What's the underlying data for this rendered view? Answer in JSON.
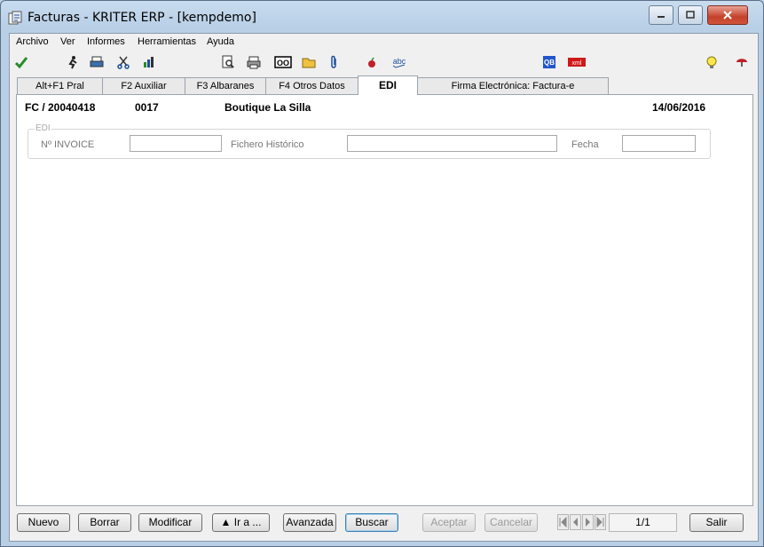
{
  "window": {
    "title": "Facturas - KRITER ERP - [kempdemo]"
  },
  "menu": [
    "Archivo",
    "Ver",
    "Informes",
    "Herramientas",
    "Ayuda"
  ],
  "toolbar": {
    "icons": [
      "check-icon",
      "run-icon",
      "print-icon",
      "scissors-icon",
      "chart-icon",
      "preview-icon",
      "printer-icon",
      "oo-icon",
      "folder-icon",
      "attach-icon",
      "apple-icon",
      "spellcheck-icon",
      "qb-icon",
      "xml-icon",
      "bulb-icon",
      "help-icon"
    ],
    "text_icons": {
      "oo": "OO",
      "abc": "abc",
      "qb": "QB",
      "xml": "xml"
    }
  },
  "tabs": [
    "Alt+F1 Pral",
    "F2 Auxiliar",
    "F3 Albaranes",
    "F4 Otros Datos",
    "EDI",
    "Firma Electrónica: Factura-e"
  ],
  "header": {
    "doc": "FC / 20040418",
    "code": "0017",
    "client": "Boutique La Silla",
    "date": "14/06/2016"
  },
  "edi": {
    "legend": "EDI",
    "invoice_label": "Nº INVOICE",
    "invoice_value": "",
    "history_label": "Fichero Histórico",
    "history_value": "",
    "date_label": "Fecha",
    "date_value": ""
  },
  "buttons": {
    "nuevo": "Nuevo",
    "borrar": "Borrar",
    "modificar": "Modificar",
    "ira": "▲ Ir a ...",
    "avanzada": "Avanzada",
    "buscar": "Buscar",
    "aceptar": "Aceptar",
    "cancelar": "Cancelar",
    "salir": "Salir"
  },
  "pager": "1/1"
}
